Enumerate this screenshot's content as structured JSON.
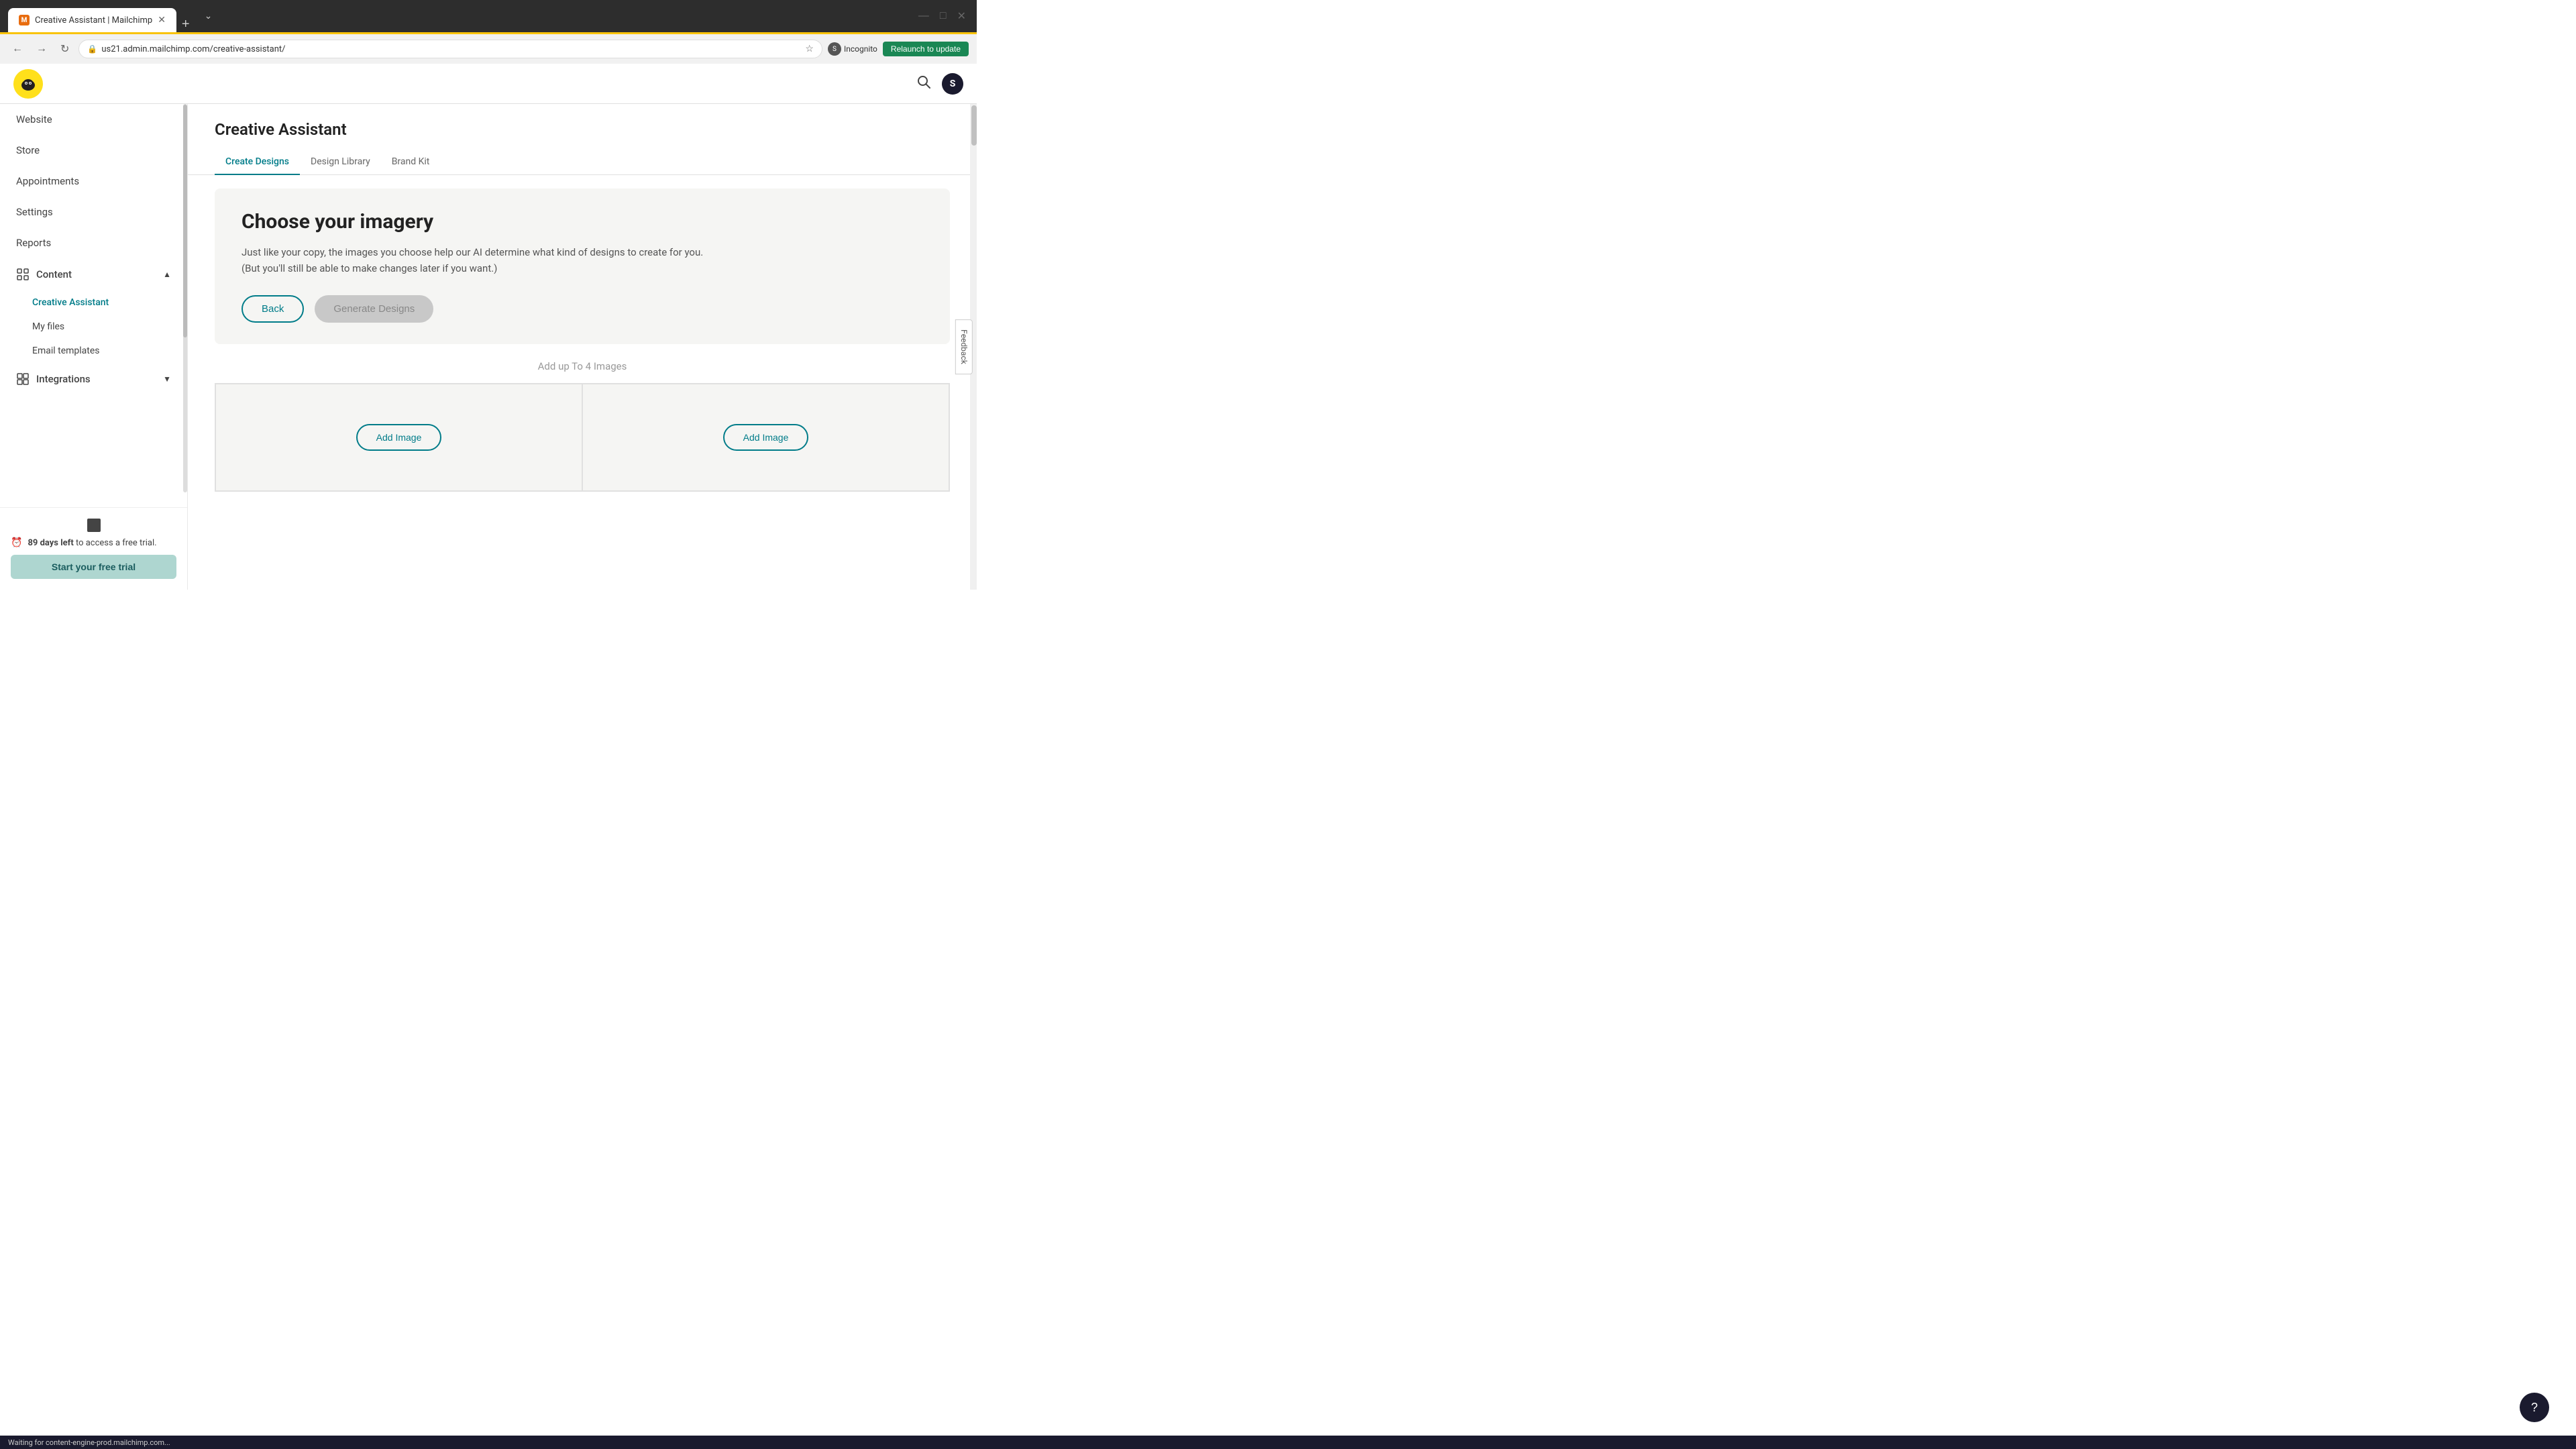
{
  "browser": {
    "tab_title": "Creative Assistant | Mailchimp",
    "tab_favicon": "M",
    "url": "us21.admin.mailchimp.com/creative-assistant/",
    "new_tab_label": "+",
    "incognito_label": "Incognito",
    "relaunch_label": "Relaunch to update"
  },
  "header": {
    "logo_letter": "M",
    "avatar_letter": "S"
  },
  "sidebar": {
    "items": [
      {
        "label": "Website",
        "id": "website"
      },
      {
        "label": "Store",
        "id": "store"
      },
      {
        "label": "Appointments",
        "id": "appointments"
      },
      {
        "label": "Settings",
        "id": "settings"
      },
      {
        "label": "Reports",
        "id": "reports"
      }
    ],
    "content_section": {
      "label": "Content",
      "sub_items": [
        {
          "label": "Creative Assistant",
          "id": "creative-assistant",
          "active": true
        },
        {
          "label": "My files",
          "id": "my-files"
        },
        {
          "label": "Email templates",
          "id": "email-templates"
        }
      ]
    },
    "integrations_section": {
      "label": "Integrations"
    },
    "trial": {
      "days_bold": "89 days left",
      "days_rest": " to access a free trial.",
      "button_label": "Start your free trial"
    }
  },
  "main": {
    "page_title": "Creative Assistant",
    "tabs": [
      {
        "label": "Create Designs",
        "active": true
      },
      {
        "label": "Design Library",
        "active": false
      },
      {
        "label": "Brand Kit",
        "active": false
      }
    ],
    "imagery_section": {
      "title": "Choose your imagery",
      "description": "Just like your copy, the images you choose help our AI determine what kind of designs to create for you. (But you'll still be able to make changes later if you want.)",
      "back_button": "Back",
      "generate_button": "Generate Designs"
    },
    "add_images": {
      "label": "Add up To 4 Images",
      "buttons": [
        {
          "label": "Add Image"
        },
        {
          "label": "Add Image"
        }
      ]
    }
  },
  "feedback": {
    "label": "Feedback"
  },
  "help": {
    "label": "?"
  },
  "status_bar": {
    "text": "Waiting for content-engine-prod.mailchimp.com..."
  }
}
